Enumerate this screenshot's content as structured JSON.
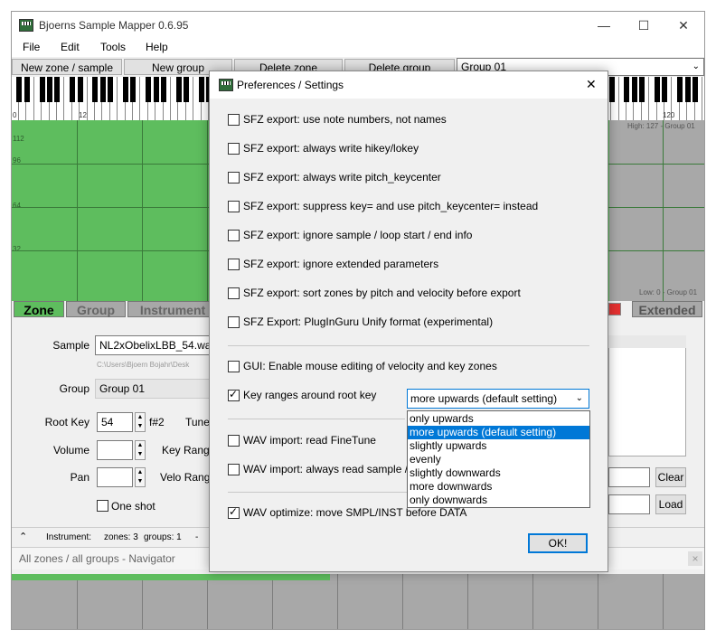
{
  "window": {
    "title": "Bjoerns Sample Mapper 0.6.95",
    "minimize": "—",
    "maximize": "☐",
    "close": "✕"
  },
  "menu": [
    "File",
    "Edit",
    "Tools",
    "Help"
  ],
  "toolbar": {
    "new_zone": "New zone / sample",
    "new_group": "New group",
    "delete_zone": "Delete zone",
    "delete_group": "Delete group",
    "group_combo": "Group 01"
  },
  "keyboard": {
    "labels": [
      "0",
      "12",
      "120"
    ]
  },
  "grid": {
    "velocity_labels": [
      "112",
      "96",
      "64",
      "32"
    ],
    "high_info": "High: 127 - Group 01",
    "low_info": "Low: 0 - Group 01"
  },
  "tabs": {
    "zone": "Zone",
    "group": "Group",
    "instrument": "Instrument",
    "extended": "Extended"
  },
  "zone_form": {
    "sample_label": "Sample",
    "sample_value": "NL2xObelixLBB_54.wav",
    "sample_path": "C:\\Users\\Bjoern Bojahr\\Desk",
    "group_label": "Group",
    "group_value": "Group 01",
    "root_key_label": "Root Key",
    "root_key_value": "54",
    "root_key_note": "f#2",
    "tune_label": "Tune",
    "volume_label": "Volume",
    "key_range_label": "Key Range",
    "pan_label": "Pan",
    "velo_range_label": "Velo Range",
    "one_shot": "One shot",
    "clear": "Clear",
    "load": "Load"
  },
  "status": {
    "instrument": "Instrument:",
    "zones": "zones: 3",
    "groups": "groups: 1",
    "dash": "-"
  },
  "navigator": {
    "title": "All zones / all groups - Navigator",
    "close": "×"
  },
  "dialog": {
    "title": "Preferences / Settings",
    "close": "✕",
    "options": [
      "SFZ export: use note numbers, not names",
      "SFZ export: always write hikey/lokey",
      "SFZ export: always write pitch_keycenter",
      "SFZ export: suppress key= and use pitch_keycenter= instead",
      "SFZ export: ignore sample / loop start / end info",
      "SFZ export: ignore extended parameters",
      "SFZ export: sort zones by pitch and velocity before export",
      "SFZ Export: PlugInGuru Unify format (experimental)"
    ],
    "gui_option": "GUI: Enable mouse editing of velocity and key zones",
    "key_ranges_option": "Key ranges around root key",
    "key_ranges_selected": "more upwards (default setting)",
    "dropdown_options": [
      "only upwards",
      "more upwards (default setting)",
      "slightly upwards",
      "evenly",
      "slightly downwards",
      "more downwards",
      "only downwards"
    ],
    "wav_finetune": "WAV import: read FineTune",
    "wav_loop": "WAV import: always read sample /",
    "wav_optimize": "WAV optimize: move SMPL/INST before DATA",
    "ok": "OK!"
  }
}
